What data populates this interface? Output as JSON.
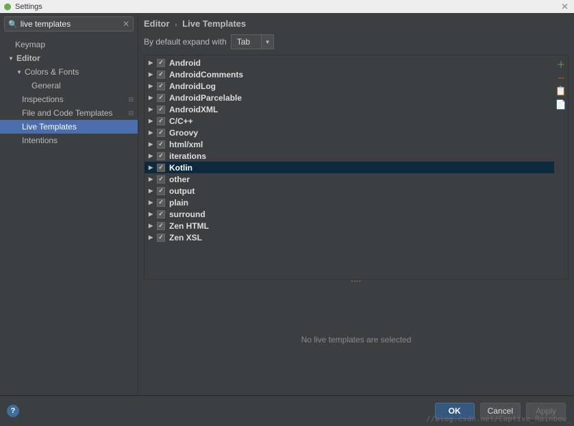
{
  "title": "Settings",
  "search": {
    "query": "live templates"
  },
  "sidebar": {
    "items": [
      {
        "label": "Keymap",
        "indent": 22,
        "arrow": "",
        "bold": false
      },
      {
        "label": "Editor",
        "indent": 12,
        "arrow": "▼",
        "bold": true
      },
      {
        "label": "Colors & Fonts",
        "indent": 24,
        "arrow": "▼",
        "bold": false
      },
      {
        "label": "General",
        "indent": 46,
        "arrow": "",
        "bold": false
      },
      {
        "label": "Inspections",
        "indent": 32,
        "arrow": "",
        "bold": false,
        "badge": "⊟"
      },
      {
        "label": "File and Code Templates",
        "indent": 32,
        "arrow": "",
        "bold": false,
        "badge": "⊟"
      },
      {
        "label": "Live Templates",
        "indent": 32,
        "arrow": "",
        "bold": false,
        "selected": true
      },
      {
        "label": "Intentions",
        "indent": 32,
        "arrow": "",
        "bold": false
      }
    ]
  },
  "breadcrumb": {
    "root": "Editor",
    "leaf": "Live Templates"
  },
  "expand": {
    "label": "By default expand with",
    "value": "Tab"
  },
  "templates": [
    {
      "label": "Android",
      "checked": true
    },
    {
      "label": "AndroidComments",
      "checked": true
    },
    {
      "label": "AndroidLog",
      "checked": true
    },
    {
      "label": "AndroidParcelable",
      "checked": true
    },
    {
      "label": "AndroidXML",
      "checked": true
    },
    {
      "label": "C/C++",
      "checked": true
    },
    {
      "label": "Groovy",
      "checked": true
    },
    {
      "label": "html/xml",
      "checked": true
    },
    {
      "label": "iterations",
      "checked": true
    },
    {
      "label": "Kotlin",
      "checked": true,
      "selected": true
    },
    {
      "label": "other",
      "checked": true
    },
    {
      "label": "output",
      "checked": true
    },
    {
      "label": "plain",
      "checked": true
    },
    {
      "label": "surround",
      "checked": true
    },
    {
      "label": "Zen HTML",
      "checked": true
    },
    {
      "label": "Zen XSL",
      "checked": true
    }
  ],
  "detail": {
    "empty_text": "No live templates are selected"
  },
  "buttons": {
    "ok": "OK",
    "cancel": "Cancel",
    "apply": "Apply"
  },
  "watermark": "//blog.csdn.net/Captive_Rainbow_"
}
